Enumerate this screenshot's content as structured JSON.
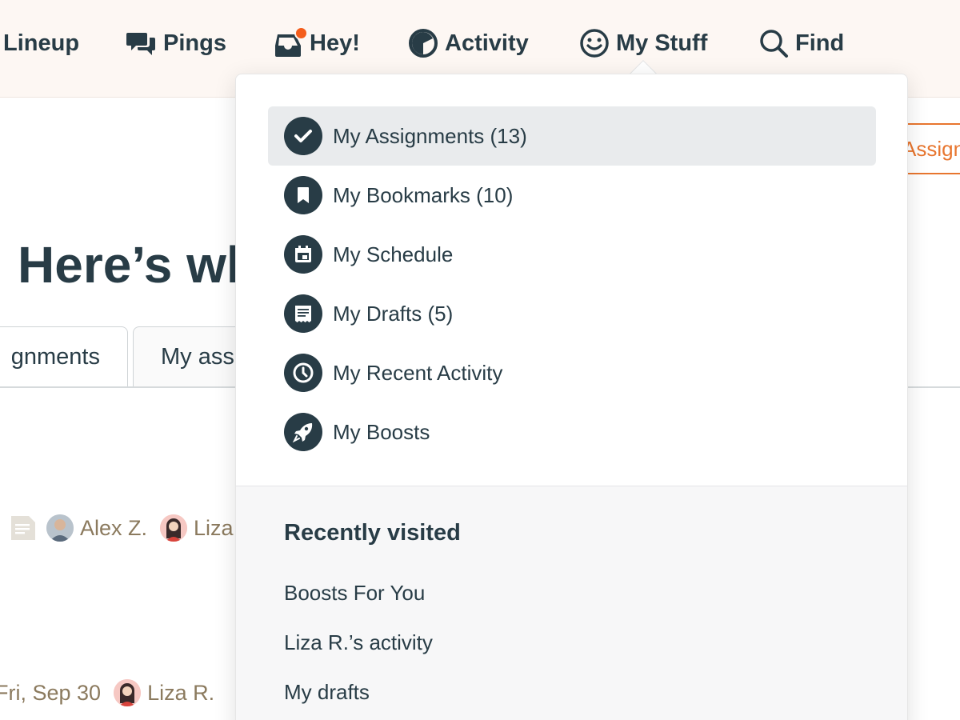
{
  "nav": {
    "items": [
      {
        "label": "Lineup",
        "icon": "lineup-icon"
      },
      {
        "label": "Pings",
        "icon": "chat-bubbles-icon"
      },
      {
        "label": "Hey!",
        "icon": "inbox-icon",
        "badge": true
      },
      {
        "label": "Activity",
        "icon": "half-circle-icon"
      },
      {
        "label": "My Stuff",
        "icon": "smiley-icon"
      },
      {
        "label": "Find",
        "icon": "search-icon"
      }
    ]
  },
  "background": {
    "button_label": "Assignm",
    "heading": "Here’s wh",
    "tabs": [
      "gnments",
      "My ass"
    ],
    "row1": {
      "name1": "Alex Z.",
      "name2": "Liza"
    },
    "row2": {
      "date": "Fri, Sep 30",
      "name1": "Liza R."
    }
  },
  "my_stuff_menu": {
    "items": [
      {
        "label": "My Assignments (13)",
        "icon": "checkmark-icon",
        "active": true
      },
      {
        "label": "My Bookmarks (10)",
        "icon": "bookmark-icon",
        "active": false
      },
      {
        "label": "My Schedule",
        "icon": "calendar-icon",
        "active": false
      },
      {
        "label": "My Drafts (5)",
        "icon": "draft-document-icon",
        "active": false
      },
      {
        "label": "My Recent Activity",
        "icon": "clock-icon",
        "active": false
      },
      {
        "label": "My Boosts",
        "icon": "rocket-icon",
        "active": false
      }
    ],
    "recently_visited": {
      "title": "Recently visited",
      "links": [
        "Boosts For You",
        "Liza R.’s activity",
        "My drafts"
      ]
    }
  },
  "colors": {
    "nav_bg": "#fdf7f3",
    "text": "#283c46",
    "accent_orange": "#e8762f",
    "badge": "#f45d1b",
    "meta_text": "#8b7a5e"
  }
}
